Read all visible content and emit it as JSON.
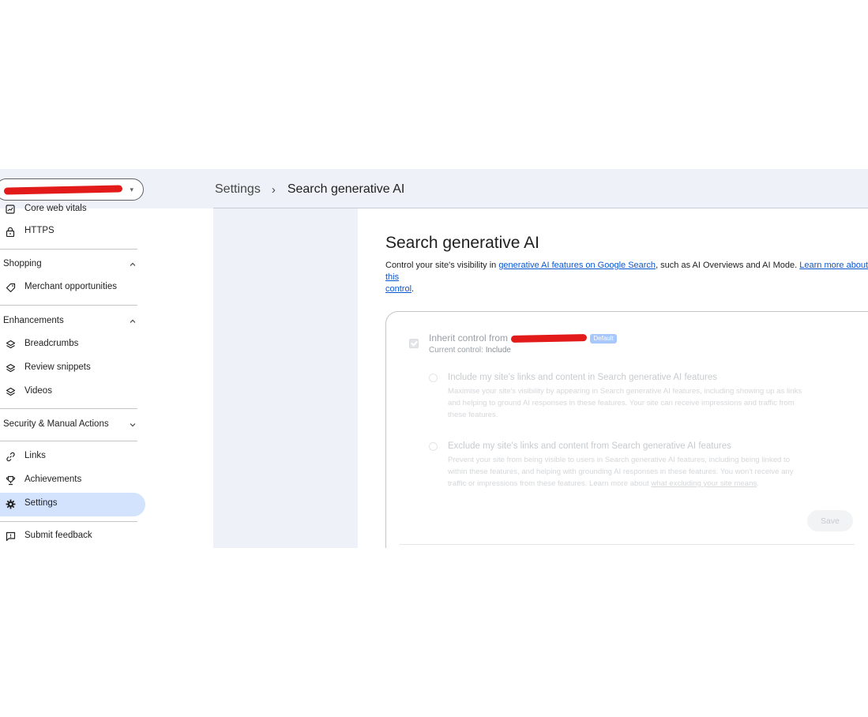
{
  "header": {
    "property_caret": "▾",
    "breadcrumb": {
      "parent": "Settings",
      "separator": "›",
      "current": "Search generative AI"
    }
  },
  "sidebar": {
    "items_top": [
      {
        "label": "Core web vitals",
        "icon": "core-web-vitals-icon"
      },
      {
        "label": "HTTPS",
        "icon": "lock-icon"
      }
    ],
    "shopping": {
      "header": "Shopping",
      "items": [
        {
          "label": "Merchant opportunities",
          "icon": "tag-icon"
        }
      ]
    },
    "enhancements": {
      "header": "Enhancements",
      "items": [
        {
          "label": "Breadcrumbs",
          "icon": "layers-icon"
        },
        {
          "label": "Review snippets",
          "icon": "layers-icon"
        },
        {
          "label": "Videos",
          "icon": "layers-icon"
        }
      ]
    },
    "security": {
      "header": "Security & Manual Actions"
    },
    "items_bottom": [
      {
        "label": "Links",
        "icon": "link-icon"
      },
      {
        "label": "Achievements",
        "icon": "trophy-icon"
      },
      {
        "label": "Settings",
        "icon": "gear-icon",
        "active": true
      }
    ],
    "feedback": {
      "label": "Submit feedback",
      "icon": "feedback-icon"
    }
  },
  "main": {
    "title": "Search generative AI",
    "description": {
      "prefix": "Control your site's visibility in ",
      "link1": "generative AI features on Google Search",
      "middle": ", such as AI Overviews and AI Mode. ",
      "link2a": "Learn more about this",
      "link2b": "control",
      "suffix": "."
    },
    "card": {
      "inherit_label": "Inherit control from",
      "default_badge": "Default",
      "current_control_label": "Current control:",
      "current_control_value": "Include",
      "option_include": {
        "title": "Include my site's links and content in Search generative AI features",
        "desc1": "Maximise your site's visibility by appearing in Search generative AI features, including showing up as links",
        "desc2": "and helping to ground AI responses in these features. Your site can receive impressions and traffic from",
        "desc3": "these features."
      },
      "option_exclude": {
        "title": "Exclude my site's links and content from Search generative AI features",
        "desc1": "Prevent your site from being visible to users in Search generative AI features, including being linked to",
        "desc2": "within these features, and helping with grounding AI responses in these features. You won't receive any",
        "desc3_prefix": "traffic or impressions from these features. Learn more about ",
        "desc3_link": "what excluding your site means",
        "desc3_suffix": "."
      },
      "save_label": "Save"
    }
  },
  "colors": {
    "accent": "#0b57d0",
    "active_bg": "#d3e3fd",
    "redaction": "#e21a1a",
    "panel_bg": "#eef2f8"
  }
}
